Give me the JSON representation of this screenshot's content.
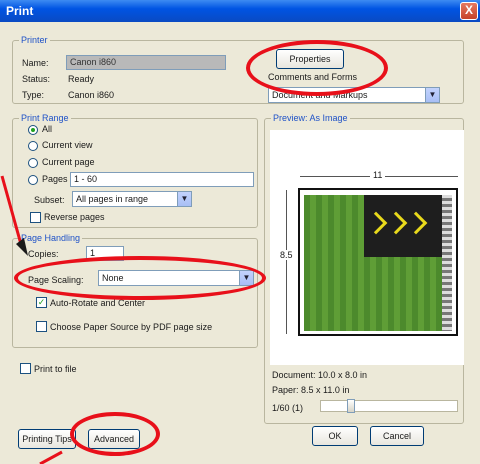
{
  "window": {
    "title": "Print",
    "close_glyph": "X"
  },
  "printer": {
    "legend": "Printer",
    "name_label": "Name:",
    "name_value": "Canon i860",
    "status_label": "Status:",
    "status_value": "Ready",
    "type_label": "Type:",
    "type_value": "Canon i860",
    "properties_button": "Properties",
    "comments_label": "Comments and Forms",
    "comments_value": "Document and Markups"
  },
  "print_range": {
    "legend": "Print Range",
    "options": [
      "All",
      "Current view",
      "Current page",
      "Pages"
    ],
    "selected_index": 0,
    "pages_value": "1 - 60",
    "subset_label": "Subset:",
    "subset_value": "All pages in range",
    "reverse_label": "Reverse pages",
    "reverse_checked": false
  },
  "page_handling": {
    "legend": "Page Handling",
    "copies_label": "Copies:",
    "copies_value": "1",
    "scaling_label": "Page Scaling:",
    "scaling_value": "None",
    "auto_rotate_label": "Auto-Rotate and Center",
    "auto_rotate_checked": true,
    "paper_source_label": "Choose Paper Source by PDF page size",
    "paper_source_checked": false
  },
  "print_to_file": {
    "label": "Print to file",
    "checked": false
  },
  "preview": {
    "legend": "Preview: As Image",
    "width_label": "11",
    "height_label": "8.5",
    "document_size": "Document: 10.0 x 8.0 in",
    "paper_size": "Paper: 8.5 x 11.0 in",
    "page_counter": "1/60 (1)"
  },
  "buttons": {
    "printing_tips": "Printing Tips",
    "advanced": "Advanced",
    "ok": "OK",
    "cancel": "Cancel"
  },
  "annotation_color": "#e8101a"
}
